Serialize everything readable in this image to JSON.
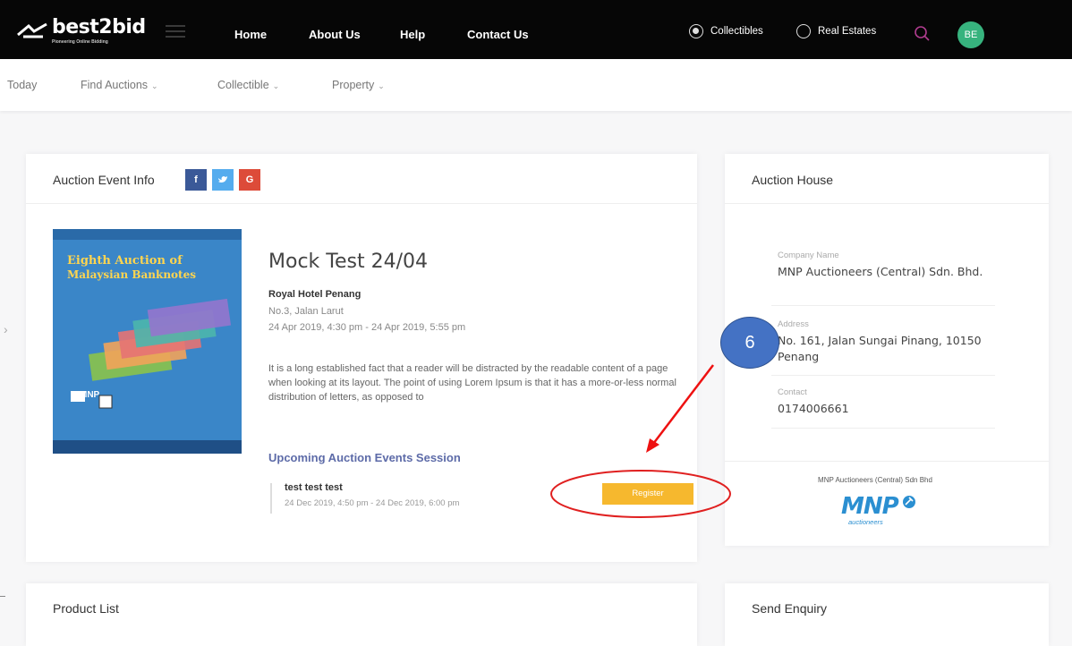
{
  "brand": {
    "name": "best2bid",
    "tagline": "Pioneering Online Bidding"
  },
  "colors": {
    "topbar": "#060606",
    "avatar": "#37b37e",
    "register": "#f6b82e",
    "link": "#5d6ba8",
    "annotation": "#4472c4",
    "annotation_arrow": "#ff0000"
  },
  "nav": {
    "home": "Home",
    "about": "About Us",
    "help": "Help",
    "contact": "Contact Us"
  },
  "category_toggle": {
    "collectibles": "Collectibles",
    "real_estates": "Real Estates",
    "selected": "Collectibles"
  },
  "user": {
    "initials": "BE"
  },
  "subnav": {
    "today": "Today",
    "find_auctions": "Find Auctions",
    "collectible": "Collectible",
    "property": "Property"
  },
  "event_card": {
    "title": "Auction Event Info",
    "share": {
      "facebook": "f",
      "twitter": "t",
      "google": "G"
    },
    "cover": {
      "heading_line1": "Eighth Auction of",
      "heading_line2": "Malaysian Banknotes",
      "logo": "MNP"
    },
    "event_title": "Mock Test 24/04",
    "venue": "Royal Hotel Penang",
    "address": "No.3, Jalan Larut",
    "datetime": "24 Apr 2019, 4:30 pm - 24 Apr 2019, 5:55 pm",
    "description": "It is a long established fact that a reader will be distracted by the readable content of a page when looking at its layout. The point of using Lorem Ipsum is that it has a more-or-less normal distribution of letters, as opposed to",
    "upcoming_heading": "Upcoming Auction Events Session",
    "session": {
      "name": "test test test",
      "datetime": "24 Dec 2019, 4:50 pm - 24 Dec 2019, 6:00 pm"
    },
    "register_label": "Register"
  },
  "auction_house": {
    "title": "Auction House",
    "company_label": "Company Name",
    "company_value": "MNP Auctioneers (Central) Sdn. Bhd.",
    "address_label": "Address",
    "address_value": "No. 161, Jalan Sungai Pinang, 10150 Penang",
    "contact_label": "Contact",
    "contact_value": "0174006661",
    "logo_caption": "MNP Auctioneers (Central) Sdn Bhd",
    "logo_text": "MNP",
    "logo_sub": "auctioneers"
  },
  "product_list": {
    "title": "Product List"
  },
  "send_enquiry": {
    "title": "Send Enquiry"
  },
  "annotation": {
    "step": "6"
  }
}
